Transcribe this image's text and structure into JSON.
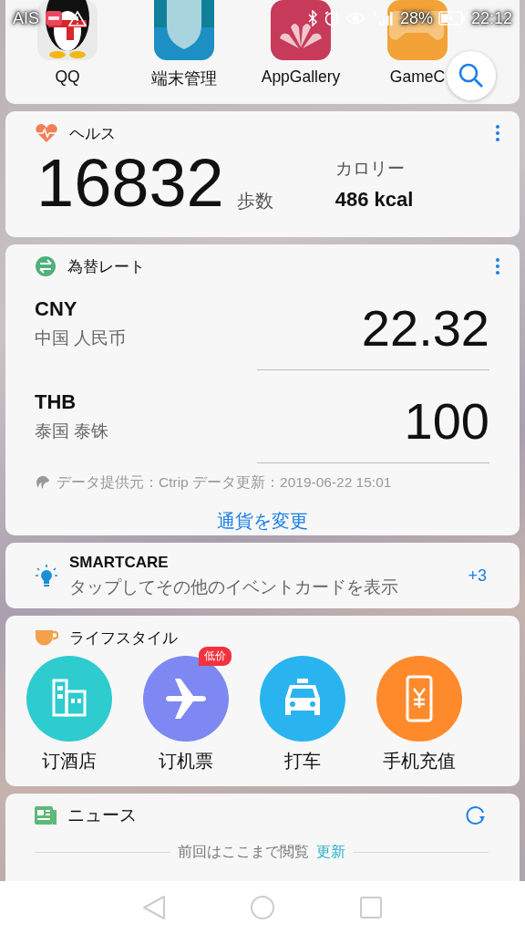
{
  "status_bar": {
    "carrier": "AIS",
    "battery": "28%",
    "time": "22:12"
  },
  "apps": [
    {
      "label": "QQ",
      "kind": "bird"
    },
    {
      "label": "端末管理",
      "kind": "shield"
    },
    {
      "label": "AppGallery",
      "kind": "flower"
    },
    {
      "label": "GameC",
      "kind": "game"
    }
  ],
  "health": {
    "title": "ヘルス",
    "steps": "16832",
    "steps_unit": "歩数",
    "calories_label": "カロリー",
    "calories": "486 kcal"
  },
  "exchange": {
    "title": "為替レート",
    "currencies": [
      {
        "code": "CNY",
        "name": "中国 人民币",
        "amount": "22.32"
      },
      {
        "code": "THB",
        "name": "泰国 泰铢",
        "amount": "100"
      }
    ],
    "source": "データ提供元：Ctrip データ更新：2019-06-22 15:01",
    "change_button": "通貨を変更"
  },
  "smartcare": {
    "title": "SMARTCARE",
    "text": "タップしてその他のイベントカードを表示",
    "count": "+3"
  },
  "lifestyle": {
    "title": "ライフスタイル",
    "services": [
      {
        "label": "订酒店",
        "kind": "hotel",
        "color": "#2ecbcf"
      },
      {
        "label": "订机票",
        "kind": "plane",
        "color": "#7d88f2",
        "badge": "低价"
      },
      {
        "label": "打车",
        "kind": "taxi",
        "color": "#2ab4ef"
      },
      {
        "label": "手机充值",
        "kind": "phone",
        "color": "#ff8a2c"
      }
    ]
  },
  "news": {
    "title": "ニュース",
    "divider_text": "前回はここまで閲覧",
    "refresh_link": "更新"
  }
}
